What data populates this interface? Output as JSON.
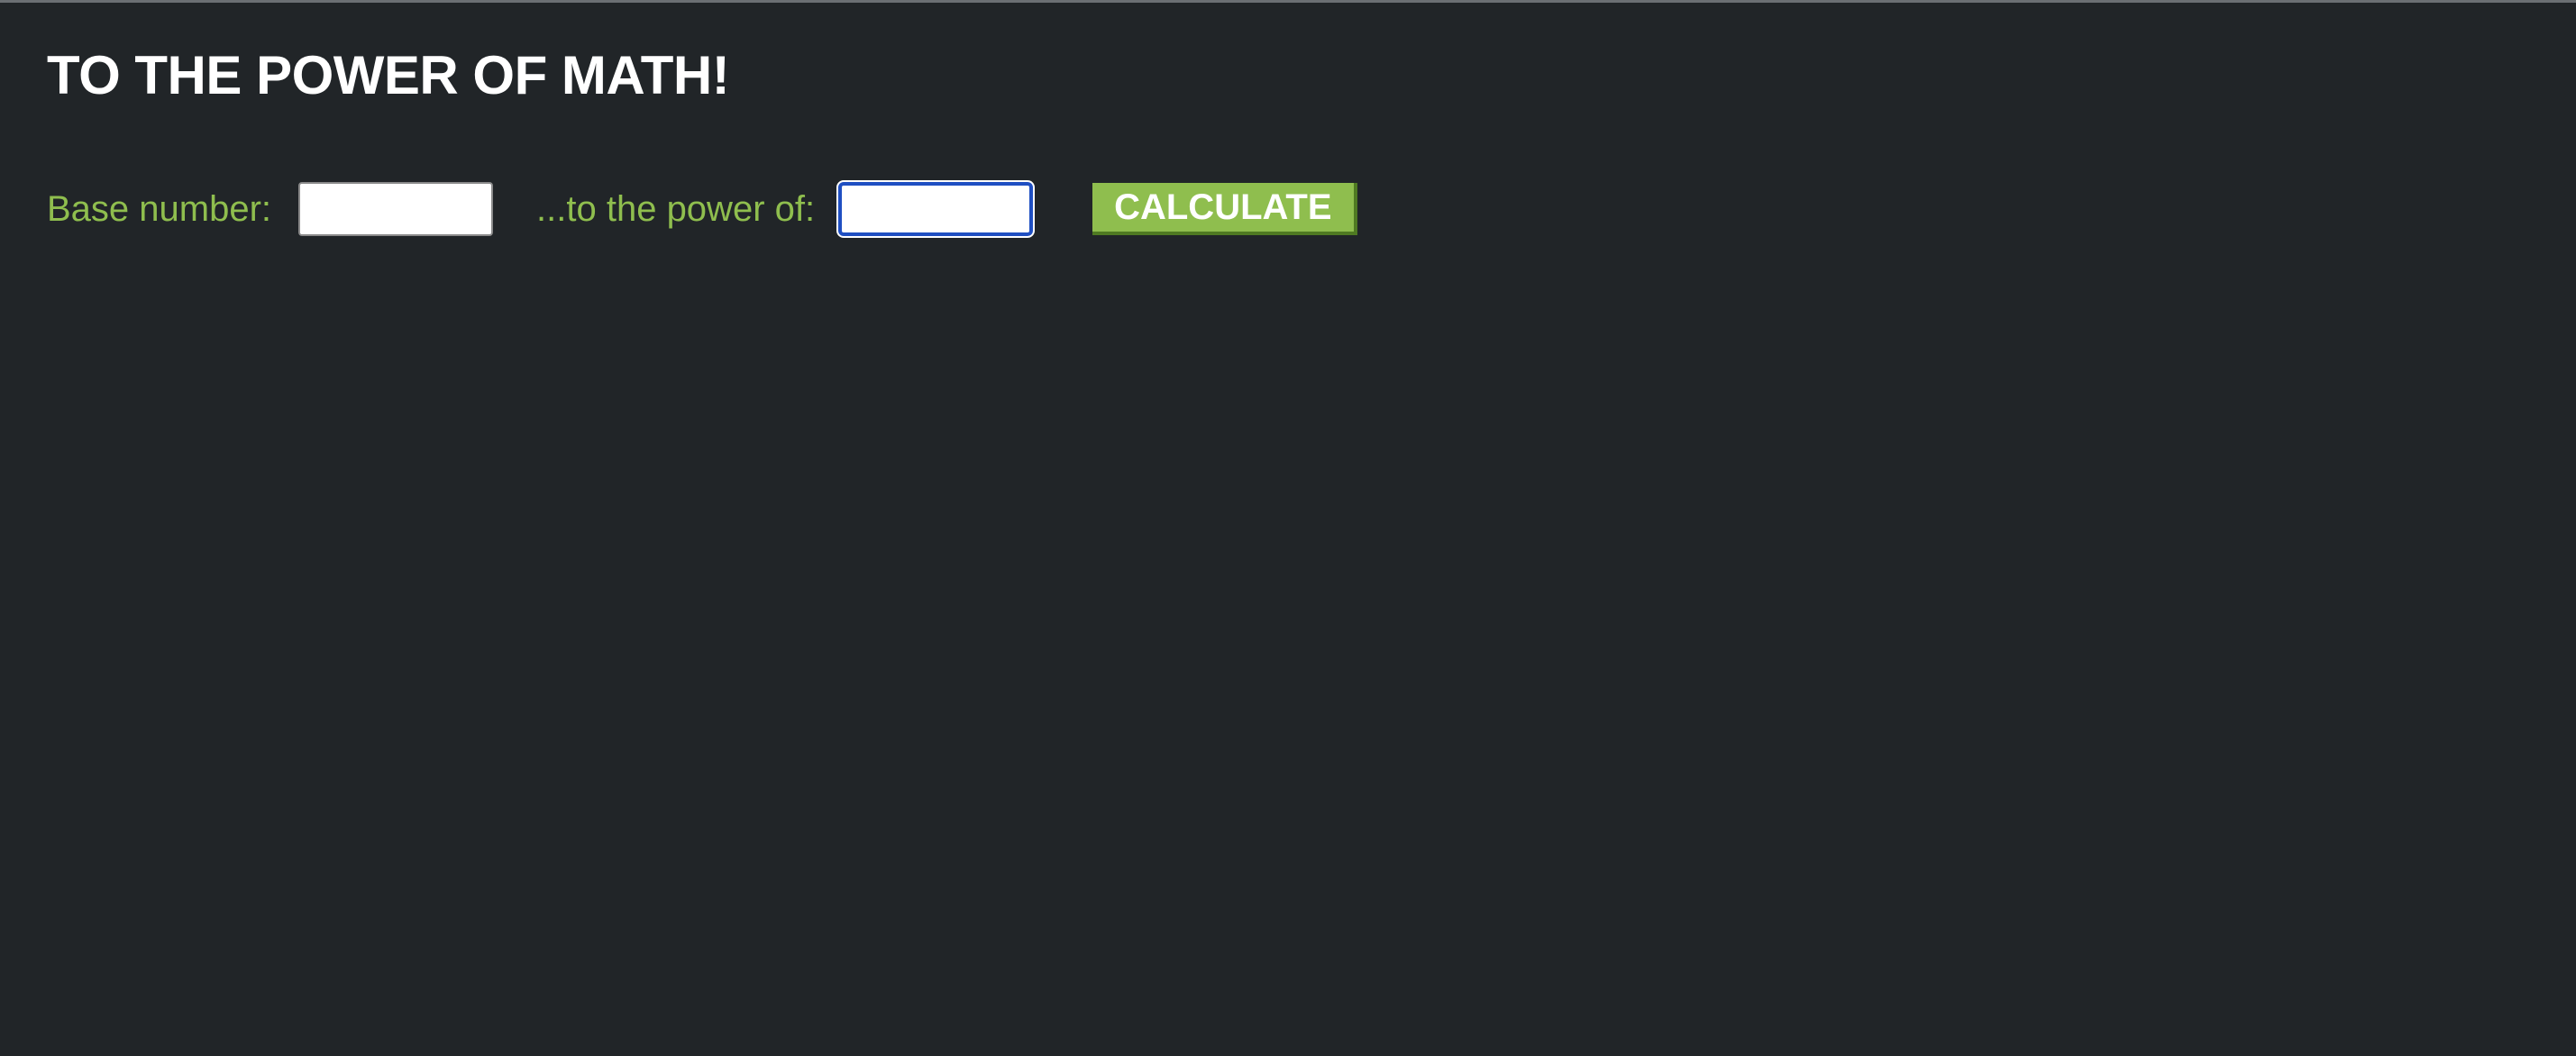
{
  "page": {
    "title": "TO THE POWER OF MATH!"
  },
  "form": {
    "base_label": "Base number:",
    "base_value": "",
    "power_label": "...to the power of:",
    "power_value": "",
    "calculate_label": "CALCULATE"
  },
  "colors": {
    "background": "#212528",
    "accent": "#8fbe4e",
    "title_text": "#ffffff",
    "focus_ring": "#1f4fc2"
  }
}
